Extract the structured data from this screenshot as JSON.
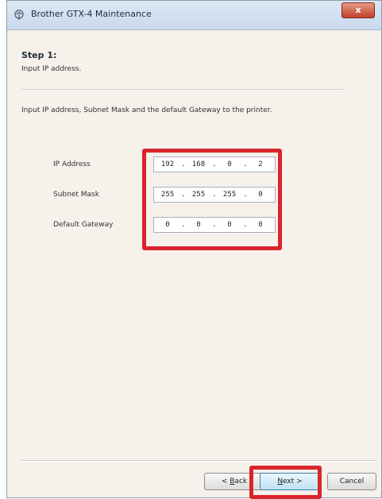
{
  "window": {
    "title": "Brother GTX-4 Maintenance",
    "close_glyph": "x"
  },
  "header": {
    "step_title": "Step 1:",
    "step_subtitle": "Input IP address."
  },
  "instruction": "Input IP address, Subnet Mask and the default Gateway to the printer.",
  "fields": [
    {
      "label": "IP Address",
      "octets": [
        "192",
        "168",
        "0",
        "2"
      ]
    },
    {
      "label": "Subnet Mask",
      "octets": [
        "255",
        "255",
        "255",
        "0"
      ]
    },
    {
      "label": "Default Gateway",
      "octets": [
        "0",
        "0",
        "0",
        "0"
      ]
    }
  ],
  "buttons": {
    "back": {
      "prefix": "< ",
      "mnemonic": "B",
      "rest": "ack"
    },
    "next": {
      "mnemonic": "N",
      "rest": "ext >"
    },
    "cancel": "Cancel"
  },
  "colors": {
    "highlight": "#d9252c",
    "dialog_bg": "#f6f1ea"
  }
}
